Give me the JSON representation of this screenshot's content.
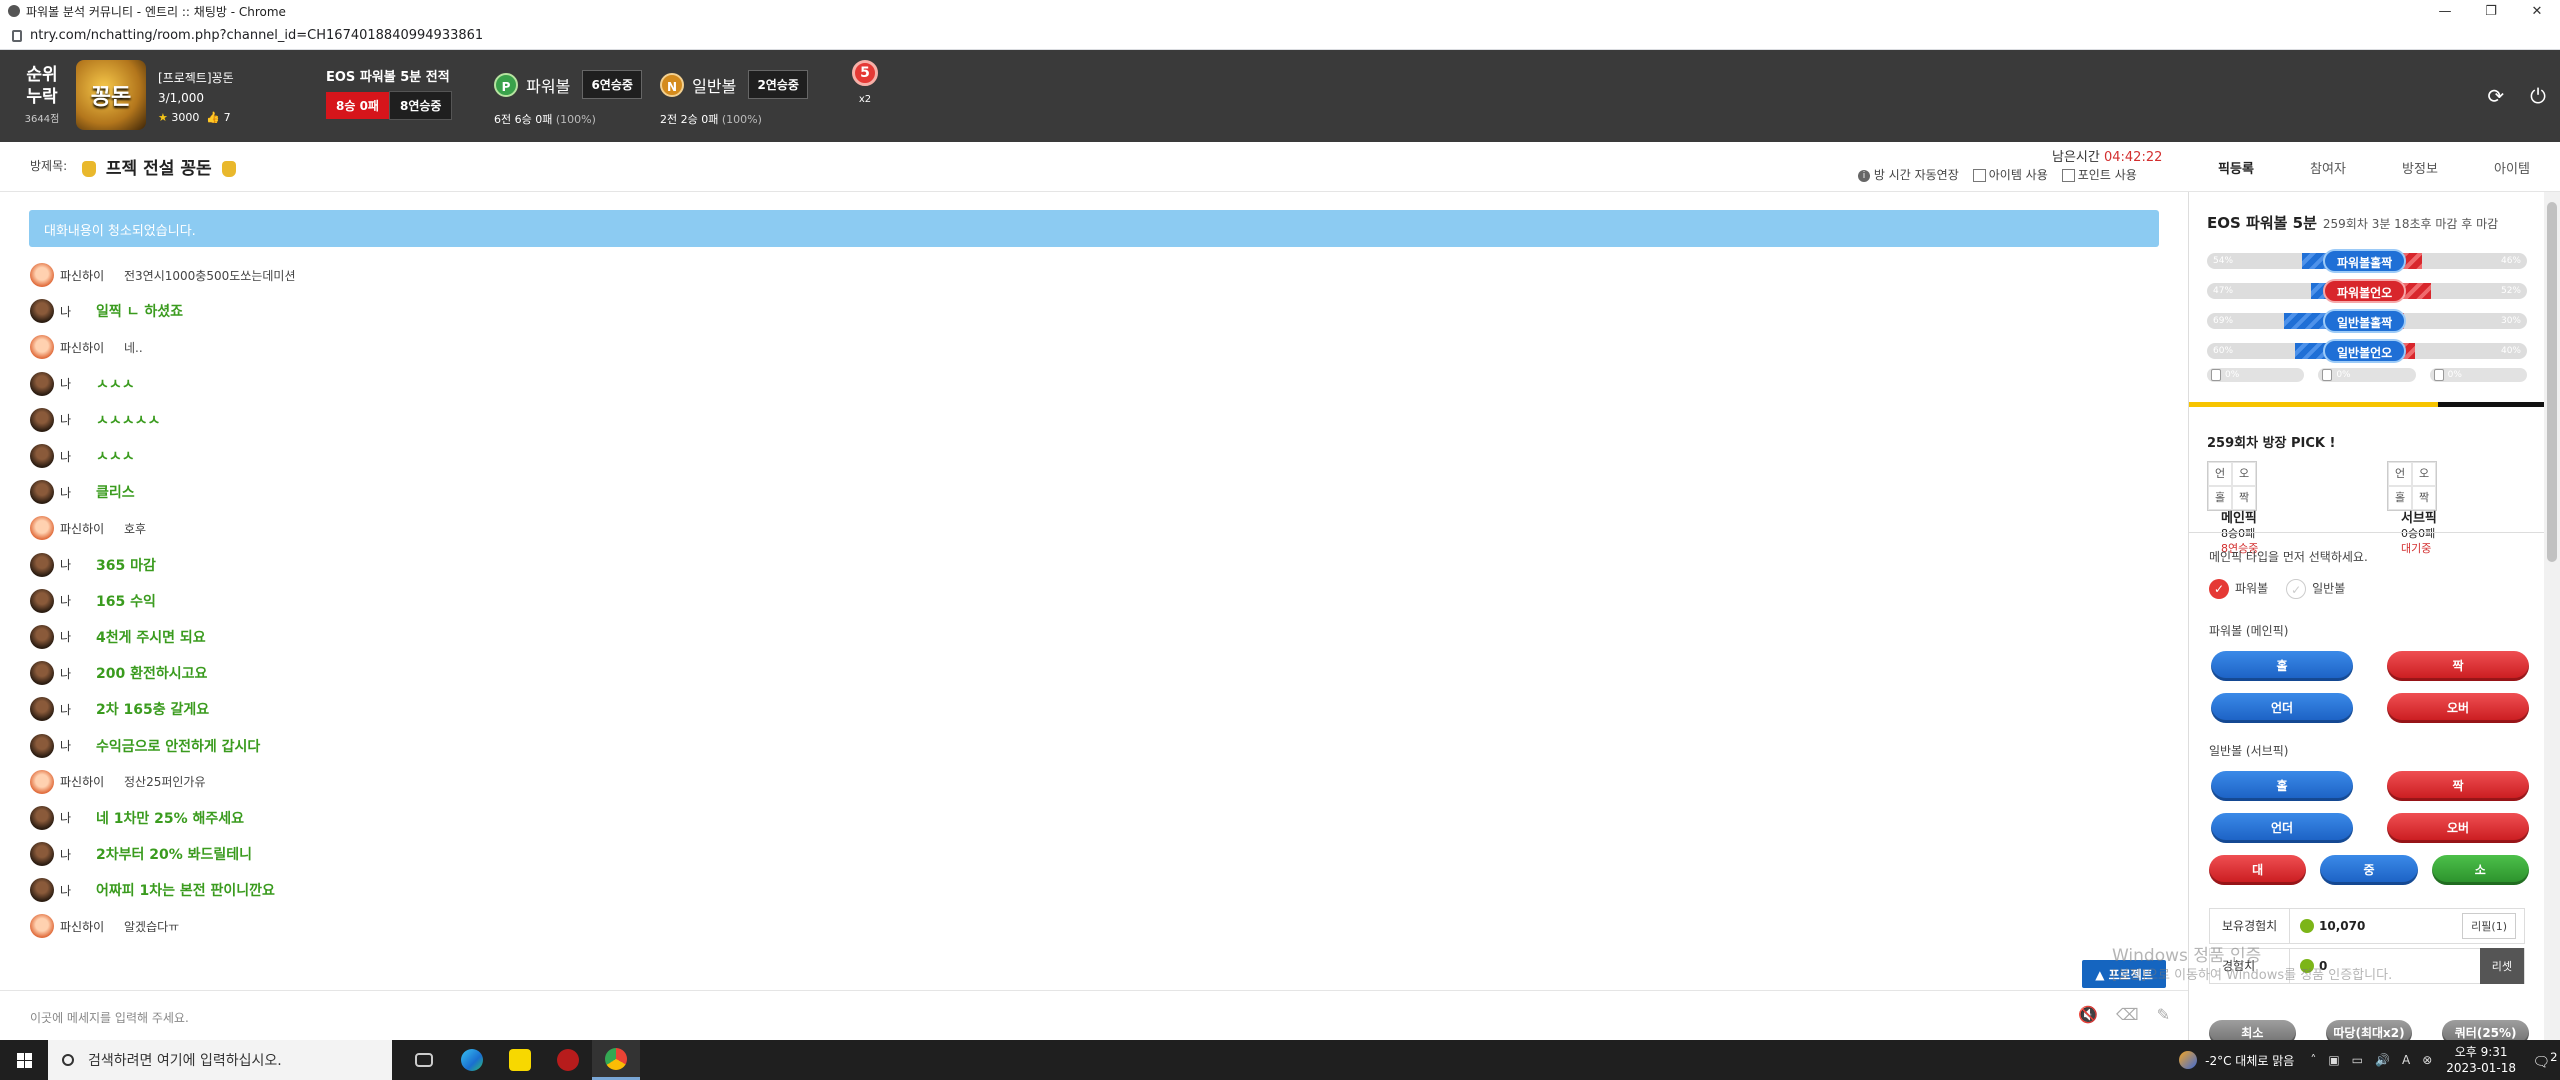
{
  "browser": {
    "tab_title": "파워볼 분석 커뮤니티 - 엔트리 :: 채팅방 - Chrome",
    "url": "ntry.com/nchatting/room.php?channel_id=CH1674018840994933861",
    "controls": [
      "—",
      "❐",
      "✕"
    ]
  },
  "header": {
    "rank_top": "순위",
    "rank_bottom": "누락",
    "points": "3644점",
    "logo_text": "꽁돈",
    "nickname": "[프로젝트]꽁돈",
    "members": "3/1,000",
    "stars": "3000",
    "likes": "7",
    "eos_title": "EOS 파워볼 5분 전적",
    "eos_record": "8승 0패",
    "eos_streak": "8연승중",
    "powerball_label": "파워볼",
    "powerball_badge": "P",
    "powerball_streak": "6연승중",
    "powerball_record": "6전 6승 0패",
    "powerball_pct": "(100%)",
    "normal_label": "일반볼",
    "normal_badge": "N",
    "normal_streak": "2연승중",
    "normal_record": "2전 2승 0패",
    "normal_pct": "(100%)",
    "medal_value": "5",
    "medal_mult": "x2"
  },
  "room": {
    "label": "방제목:",
    "title": "프젝 전설 꽁돈",
    "timer_label": "남은시간",
    "timer_value": "04:42:22",
    "opt_auto": "방 시간 자동연장",
    "opt_item": "아이템 사용",
    "opt_point": "포인트 사용",
    "tabs": [
      "픽등록",
      "참여자",
      "방정보",
      "아이템"
    ]
  },
  "chat": {
    "notice": "대화내용이 청소되었습니다.",
    "messages": [
      {
        "who": "other",
        "nick": "파신하이",
        "text": "전3연시1000충500도쏘는데미션"
      },
      {
        "who": "me",
        "nick": "나",
        "text": "일찍 ㄴ 하셨죠"
      },
      {
        "who": "other",
        "nick": "파신하이",
        "text": "네.."
      },
      {
        "who": "me",
        "nick": "나",
        "text": "ㅅㅅㅅ"
      },
      {
        "who": "me",
        "nick": "나",
        "text": "ㅅㅅㅅㅅㅅ"
      },
      {
        "who": "me",
        "nick": "나",
        "text": "ㅅㅅㅅ"
      },
      {
        "who": "me",
        "nick": "나",
        "text": "클리스"
      },
      {
        "who": "other",
        "nick": "파신하이",
        "text": "호후"
      },
      {
        "who": "me",
        "nick": "나",
        "text": "365 마감"
      },
      {
        "who": "me",
        "nick": "나",
        "text": "165 수익"
      },
      {
        "who": "me",
        "nick": "나",
        "text": "4천게 주시면 되요"
      },
      {
        "who": "me",
        "nick": "나",
        "text": "200 환전하시고요"
      },
      {
        "who": "me",
        "nick": "나",
        "text": "2차 165충 갈게요"
      },
      {
        "who": "me",
        "nick": "나",
        "text": "수익금으로 안전하게 갑시다"
      },
      {
        "who": "other",
        "nick": "파신하이",
        "text": "정산25퍼인가유"
      },
      {
        "who": "me",
        "nick": "나",
        "text": "네 1차만 25% 해주세요"
      },
      {
        "who": "me",
        "nick": "나",
        "text": "2차부터 20% 봐드릴테니"
      },
      {
        "who": "me",
        "nick": "나",
        "text": "어짜피 1차는 본전 판이니깐요"
      },
      {
        "who": "other",
        "nick": "파신하이",
        "text": "알겠습다ㅠ"
      }
    ],
    "input_placeholder": "이곳에 메세지를 입력해 주세요.",
    "promo_button": "▲ 프로젝트"
  },
  "panel": {
    "title": "EOS 파워볼 5분",
    "subtitle": "259회차 3분 18초후 마감 후 마감",
    "bars": [
      {
        "label": "파워볼홀짝",
        "left_pct": "54%",
        "right_pct": "46%",
        "left_fill": 0.54,
        "color": "blue"
      },
      {
        "label": "파워볼언오",
        "left_pct": "47%",
        "right_pct": "52%",
        "left_fill": 0.47,
        "color": "red"
      },
      {
        "label": "일반볼홀짝",
        "left_pct": "69%",
        "right_pct": "30%",
        "left_fill": 0.69,
        "color": "blue"
      },
      {
        "label": "일반볼언오",
        "left_pct": "60%",
        "right_pct": "40%",
        "left_fill": 0.6,
        "color": "blue"
      }
    ],
    "mini": [
      "0%",
      "0%",
      "0%"
    ],
    "pick_title": "259회차 방장 PICK !",
    "pick_grid": [
      "언",
      "오",
      "홀",
      "짝"
    ],
    "main_pick": {
      "title": "메인픽",
      "record": "8승0패",
      "status": "8연승중"
    },
    "sub_pick": {
      "title": "서브픽",
      "record": "0승0패",
      "status": "대기중"
    },
    "select_prompt": "메인픽 타입을 먼저 선택하세요.",
    "radio_power": "파워볼",
    "radio_normal": "일반볼",
    "power_group": "파워볼 (메인픽)",
    "power_buttons": [
      "홀",
      "짝",
      "언더",
      "오버"
    ],
    "normal_group": "일반볼 (서브픽)",
    "normal_buttons": [
      "홀",
      "짝",
      "언더",
      "오버"
    ],
    "size_buttons": [
      "대",
      "중",
      "소"
    ],
    "exp_label": "보유경험치",
    "exp_value": "10,070",
    "exp_action": "리필(1)",
    "gain_label": "경험치",
    "gain_value": "0",
    "gain_action": "리셋",
    "bottom_buttons": [
      "최소",
      "따당(최대x2)",
      "쿼터(25%)"
    ]
  },
  "watermark": {
    "line1": "Windows 정품 인증",
    "line2": "[설정]으로 이동하여 Windows를 정품 인증합니다."
  },
  "taskbar": {
    "search_placeholder": "검색하려면 여기에 입력하십시오.",
    "weather": "-2°C 대체로 맑음",
    "time": "오후 9:31",
    "date": "2023-01-18",
    "notif_count": "2"
  }
}
